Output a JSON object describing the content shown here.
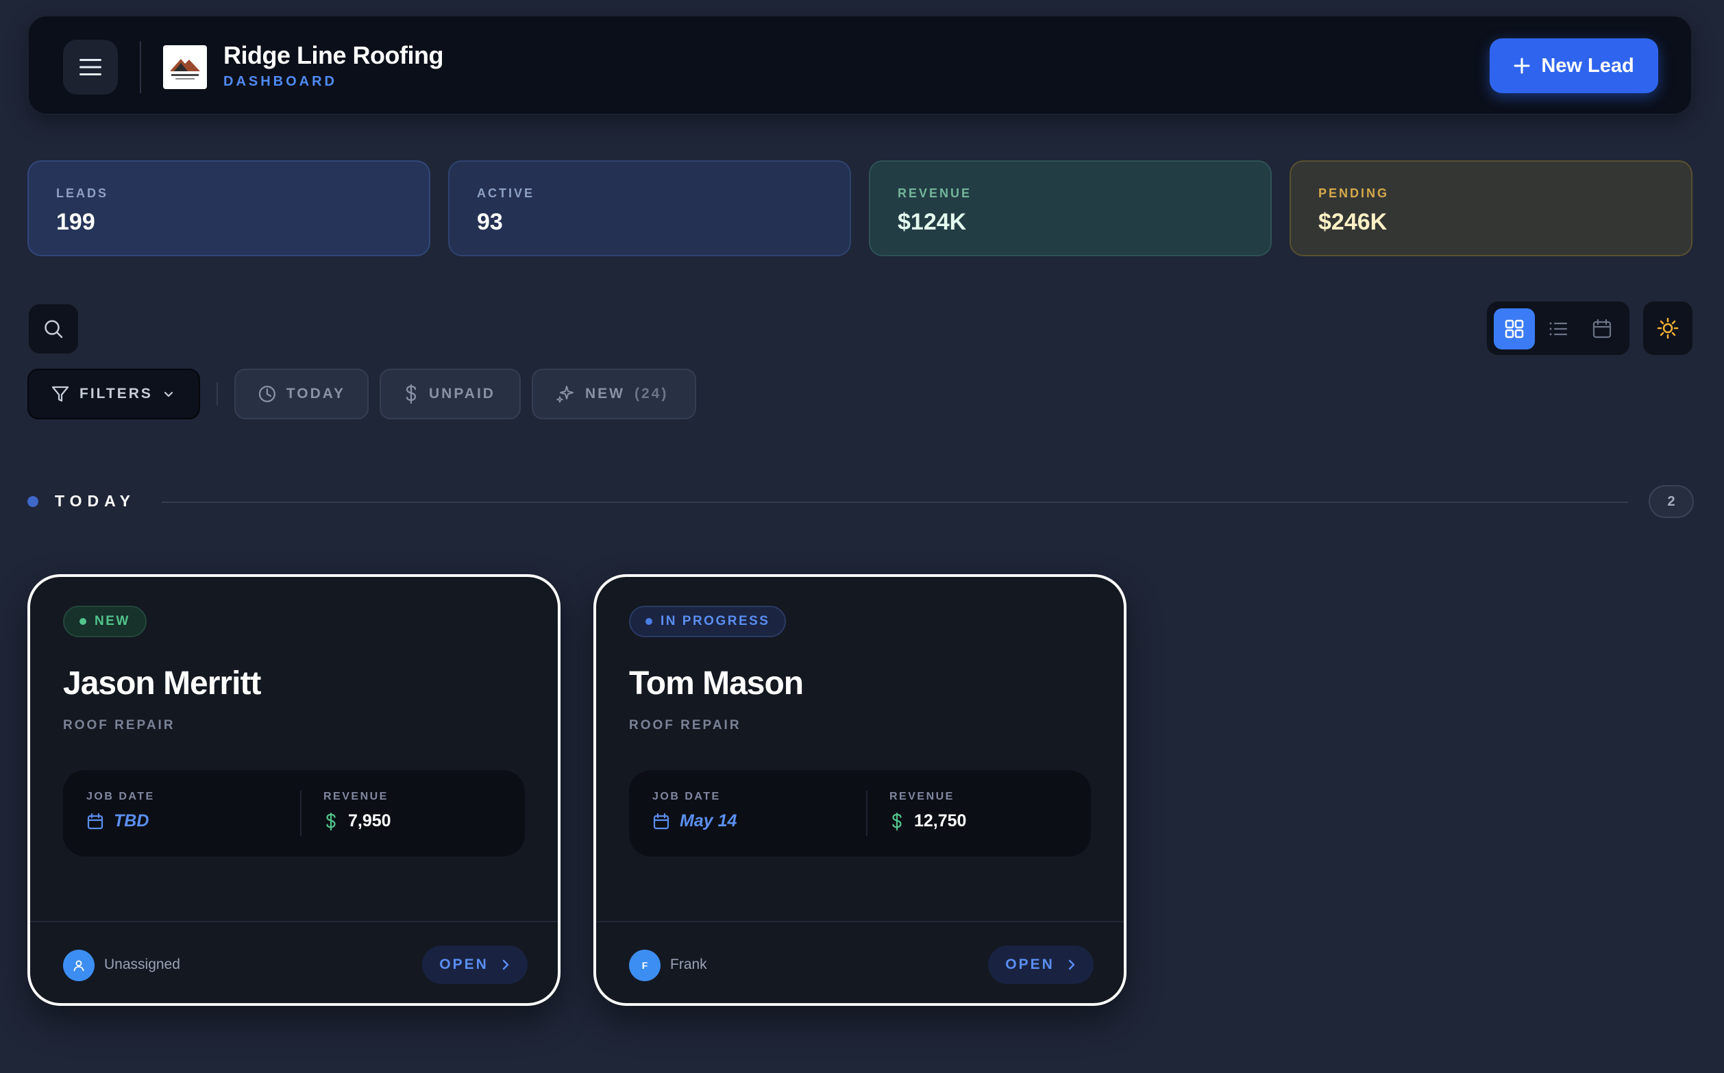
{
  "header": {
    "brand_name": "Ridge Line Roofing",
    "brand_subtitle": "DASHBOARD",
    "new_lead_label": "New Lead"
  },
  "stats": [
    {
      "label": "LEADS",
      "value": "199"
    },
    {
      "label": "ACTIVE",
      "value": "93"
    },
    {
      "label": "REVENUE",
      "value": "$124K"
    },
    {
      "label": "PENDING",
      "value": "$246K"
    }
  ],
  "toolbar": {
    "view_modes": [
      "grid-view-icon",
      "list-view-icon",
      "calendar-view-icon"
    ],
    "active_view": "grid",
    "theme_icon": "sun-icon"
  },
  "filters": {
    "filters_label": "FILTERS",
    "today_label": "TODAY",
    "unpaid_label": "UNPAID",
    "new_label": "NEW",
    "new_count": "(24)"
  },
  "section": {
    "title": "TODAY",
    "count": "2"
  },
  "cards": [
    {
      "status": "NEW",
      "status_color": "#52c48c",
      "name": "Jason Merritt",
      "job_type": "ROOF REPAIR",
      "job_date_label": "JOB DATE",
      "job_date": "TBD",
      "revenue_label": "REVENUE",
      "revenue": "7,950",
      "assignee": "Unassigned",
      "open_label": "OPEN"
    },
    {
      "status": "IN PROGRESS",
      "status_color": "#5a8ef2",
      "name": "Tom Mason",
      "job_type": "ROOF REPAIR",
      "job_date_label": "JOB DATE",
      "job_date": "May 14",
      "revenue_label": "REVENUE",
      "revenue": "12,750",
      "assignee_initial": "F",
      "assignee": "Frank",
      "open_label": "OPEN"
    }
  ],
  "colors": {
    "background": "#1f2638",
    "accent": "#2f65ee",
    "new": "#52c48c",
    "in_progress": "#5a8ef2",
    "pending": "#d6a94b"
  }
}
